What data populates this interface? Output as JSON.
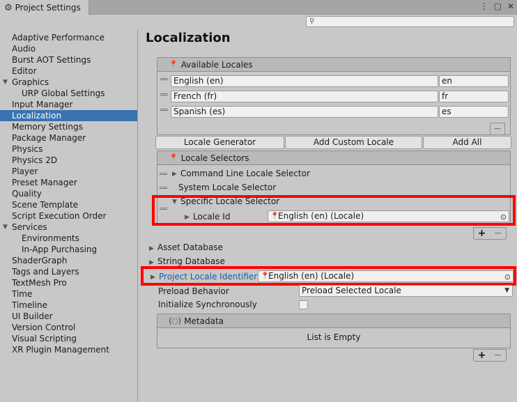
{
  "window": {
    "tab_title": "Project Settings",
    "tab_icon": "gear-icon",
    "controls": [
      "⋮",
      "▢",
      "✕"
    ]
  },
  "search": {
    "placeholder": ""
  },
  "sidebar": {
    "items": [
      {
        "label": "Adaptive Performance"
      },
      {
        "label": "Audio"
      },
      {
        "label": "Burst AOT Settings"
      },
      {
        "label": "Editor"
      },
      {
        "label": "Graphics"
      },
      {
        "label": "URP Global Settings"
      },
      {
        "label": "Input Manager"
      },
      {
        "label": "Localization"
      },
      {
        "label": "Memory Settings"
      },
      {
        "label": "Package Manager"
      },
      {
        "label": "Physics"
      },
      {
        "label": "Physics 2D"
      },
      {
        "label": "Player"
      },
      {
        "label": "Preset Manager"
      },
      {
        "label": "Quality"
      },
      {
        "label": "Scene Template"
      },
      {
        "label": "Script Execution Order"
      },
      {
        "label": "Services"
      },
      {
        "label": "Environments"
      },
      {
        "label": "In-App Purchasing"
      },
      {
        "label": "ShaderGraph"
      },
      {
        "label": "Tags and Layers"
      },
      {
        "label": "TextMesh Pro"
      },
      {
        "label": "Time"
      },
      {
        "label": "Timeline"
      },
      {
        "label": "UI Builder"
      },
      {
        "label": "Version Control"
      },
      {
        "label": "Visual Scripting"
      },
      {
        "label": "XR Plugin Management"
      }
    ],
    "selected": "Localization"
  },
  "main": {
    "title": "Localization",
    "available_locales": {
      "header": "Available Locales",
      "rows": [
        {
          "name": "English (en)",
          "code": "en"
        },
        {
          "name": "French (fr)",
          "code": "fr"
        },
        {
          "name": "Spanish (es)",
          "code": "es"
        }
      ],
      "minus": "−"
    },
    "buttons": {
      "locale_generator": "Locale Generator",
      "add_custom_locale": "Add Custom Locale",
      "add_all": "Add All"
    },
    "locale_selectors": {
      "header": "Locale Selectors",
      "items": {
        "command_line": "Command Line Locale Selector",
        "system": "System Locale Selector",
        "specific": "Specific Locale Selector"
      },
      "locale_id_label": "Locale Id",
      "locale_id_value": "English (en) (Locale)",
      "plus": "+",
      "minus": "−"
    },
    "asset_database": "Asset Database",
    "string_database": "String Database",
    "project_locale_identifier": {
      "label": "Project Locale Identifier",
      "value": "English (en) (Locale)"
    },
    "preload_behavior": {
      "label": "Preload Behavior",
      "value": "Preload Selected Locale"
    },
    "initialize_synchronously": {
      "label": "Initialize Synchronously",
      "checked": false
    },
    "metadata": {
      "header": "Metadata",
      "empty_text": "List is Empty",
      "plus": "+",
      "minus": "−"
    }
  },
  "colors": {
    "background": "#c8c8c8",
    "selection": "#3a72b0",
    "highlight_box": "#ff0000",
    "link": "#1e5aa8"
  }
}
